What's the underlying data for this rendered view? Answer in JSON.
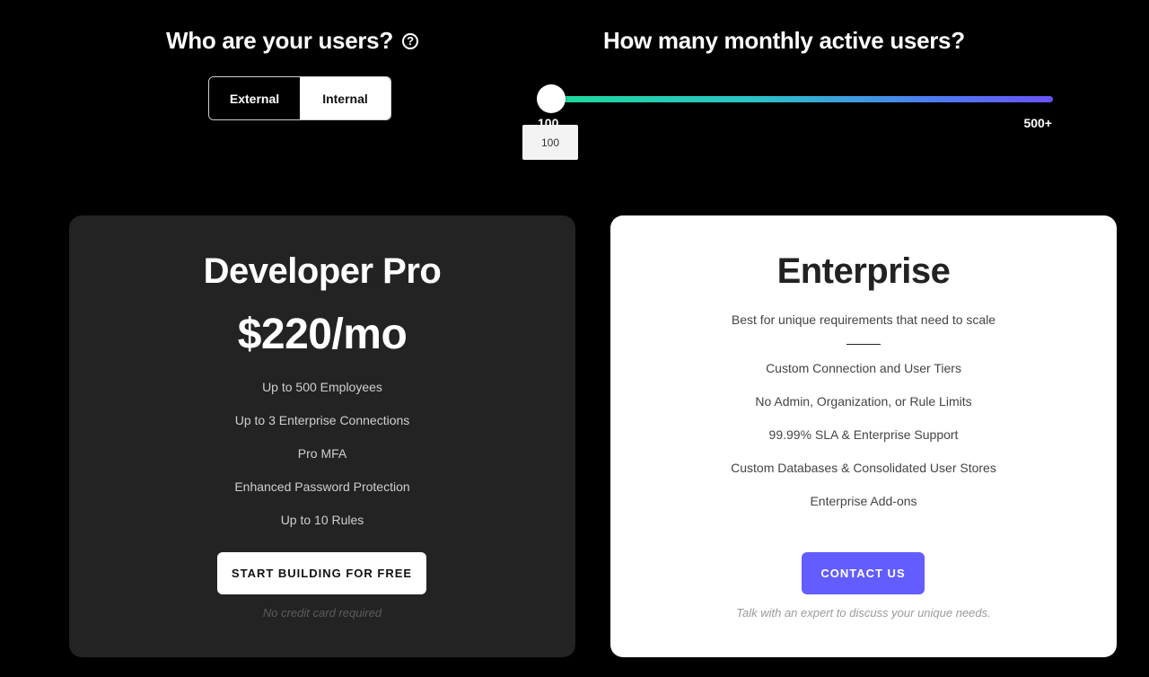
{
  "users_question": {
    "title": "Who are your users?",
    "help_icon": "question-circle-icon"
  },
  "user_type_toggle": {
    "options": [
      "External",
      "Internal"
    ],
    "selected": "Internal"
  },
  "mau_question": {
    "title": "How many monthly active users?"
  },
  "mau_slider": {
    "min_label": "100",
    "max_label": "500+",
    "tooltip": "100",
    "position_fraction": 0,
    "gradient_colors": [
      "#1fd89a",
      "#2bc3c7",
      "#4c7ef0",
      "#6a52f5"
    ]
  },
  "developer_pro": {
    "name": "Developer Pro",
    "price": "$220/mo",
    "features": [
      "Up to 500 Employees",
      "Up to 3 Enterprise Connections",
      "Pro MFA",
      "Enhanced Password Protection",
      "Up to 10 Rules"
    ],
    "cta": "START BUILDING FOR FREE",
    "note": "No credit card required"
  },
  "enterprise": {
    "name": "Enterprise",
    "tagline": "Best for unique requirements that need to scale",
    "features": [
      "Custom Connection and User Tiers",
      "No Admin, Organization, or Rule Limits",
      "99.99% SLA & Enterprise Support",
      "Custom Databases & Consolidated User Stores",
      "Enterprise Add-ons"
    ],
    "cta": "CONTACT US",
    "note": "Talk with an expert to discuss your unique needs.",
    "accent_color": "#635dff"
  }
}
